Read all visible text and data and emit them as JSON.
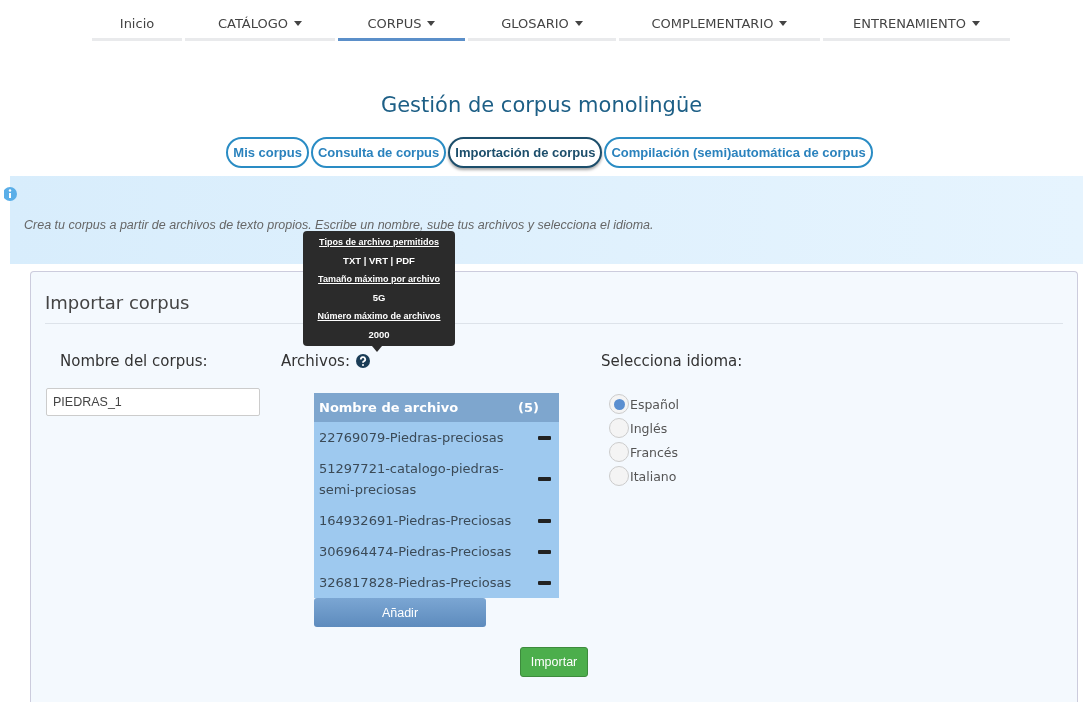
{
  "nav": [
    {
      "label": "Inicio",
      "dropdown": false,
      "selected": false
    },
    {
      "label": "CATÁLOGO",
      "dropdown": true,
      "selected": false
    },
    {
      "label": "CORPUS",
      "dropdown": true,
      "selected": true
    },
    {
      "label": "GLOSARIO",
      "dropdown": true,
      "selected": false
    },
    {
      "label": "COMPLEMENTARIO",
      "dropdown": true,
      "selected": false
    },
    {
      "label": "ENTRENAMIENTO",
      "dropdown": true,
      "selected": false
    }
  ],
  "title": "Gestión de corpus monolingüe",
  "tabs": [
    {
      "label": "Mis corpus",
      "selected": false
    },
    {
      "label": "Consulta de corpus",
      "selected": false
    },
    {
      "label": "Importación de corpus",
      "selected": true
    },
    {
      "label": "Compilación (semi)automática de corpus",
      "selected": false
    }
  ],
  "info": "Crea tu corpus a partir de archivos de texto propios. Escribe un nombre, sube tus archivos y selecciona el idioma.",
  "panel": {
    "title": "Importar corpus",
    "name_label": "Nombre del corpus:",
    "name_value": "PIEDRAS_1",
    "files_label": "Archivos:",
    "tooltip": [
      {
        "heading": "Tipos de archivo permitidos",
        "value": "TXT | VRT | PDF"
      },
      {
        "heading": "Tamaño máximo por archivo",
        "value": "5G"
      },
      {
        "heading": "Número máximo de archivos",
        "value": "2000"
      }
    ],
    "files_header": "Nombre de archivo",
    "files_count": "(5)",
    "files": [
      "22769079-Piedras-preciosas",
      "51297721-catalogo-piedras-semi-preciosas",
      "164932691-Piedras-Preciosas",
      "306964474-Piedras-Preciosas",
      "326817828-Piedras-Preciosas"
    ],
    "add_button": "Añadir",
    "language_label": "Selecciona idioma:",
    "languages": [
      {
        "label": "Español",
        "selected": true
      },
      {
        "label": "Inglés",
        "selected": false
      },
      {
        "label": "Francés",
        "selected": false
      },
      {
        "label": "Italiano",
        "selected": false
      }
    ],
    "import_button": "Importar"
  }
}
